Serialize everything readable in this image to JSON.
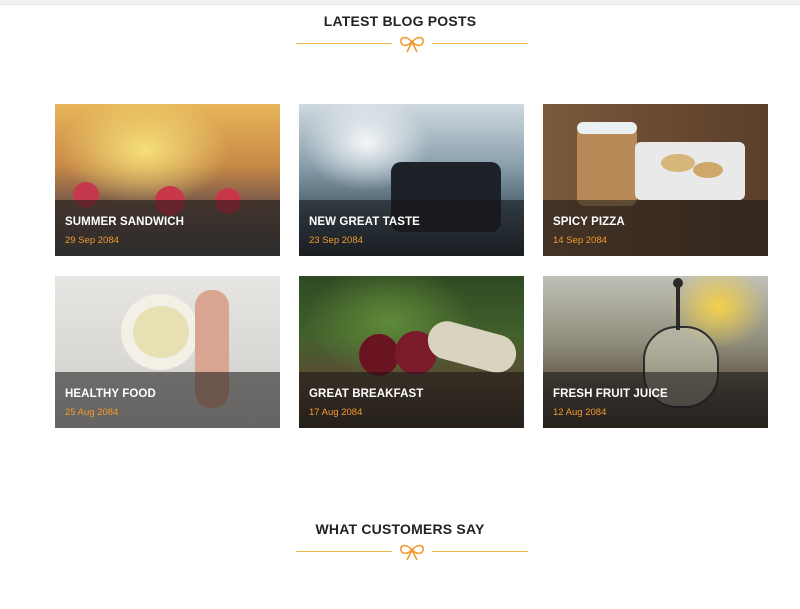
{
  "sections": {
    "blog": {
      "title": "LATEST BLOG POSTS"
    },
    "customers": {
      "title": "WHAT CUSTOMERS SAY"
    }
  },
  "accent_color": "#f29a2e",
  "blog_posts": [
    {
      "title": "SUMMER SANDWICH",
      "date": "29 Sep 2084"
    },
    {
      "title": "NEW GREAT TASTE",
      "date": "23 Sep 2084"
    },
    {
      "title": "SPICY PIZZA",
      "date": "14 Sep 2084"
    },
    {
      "title": "HEALTHY FOOD",
      "date": "25 Aug 2084"
    },
    {
      "title": "GREAT BREAKFAST",
      "date": "17 Aug 2084"
    },
    {
      "title": "FRESH FRUIT JUICE",
      "date": "12 Aug 2084"
    }
  ],
  "icons": {
    "divider": "ribbon-bow-icon"
  }
}
